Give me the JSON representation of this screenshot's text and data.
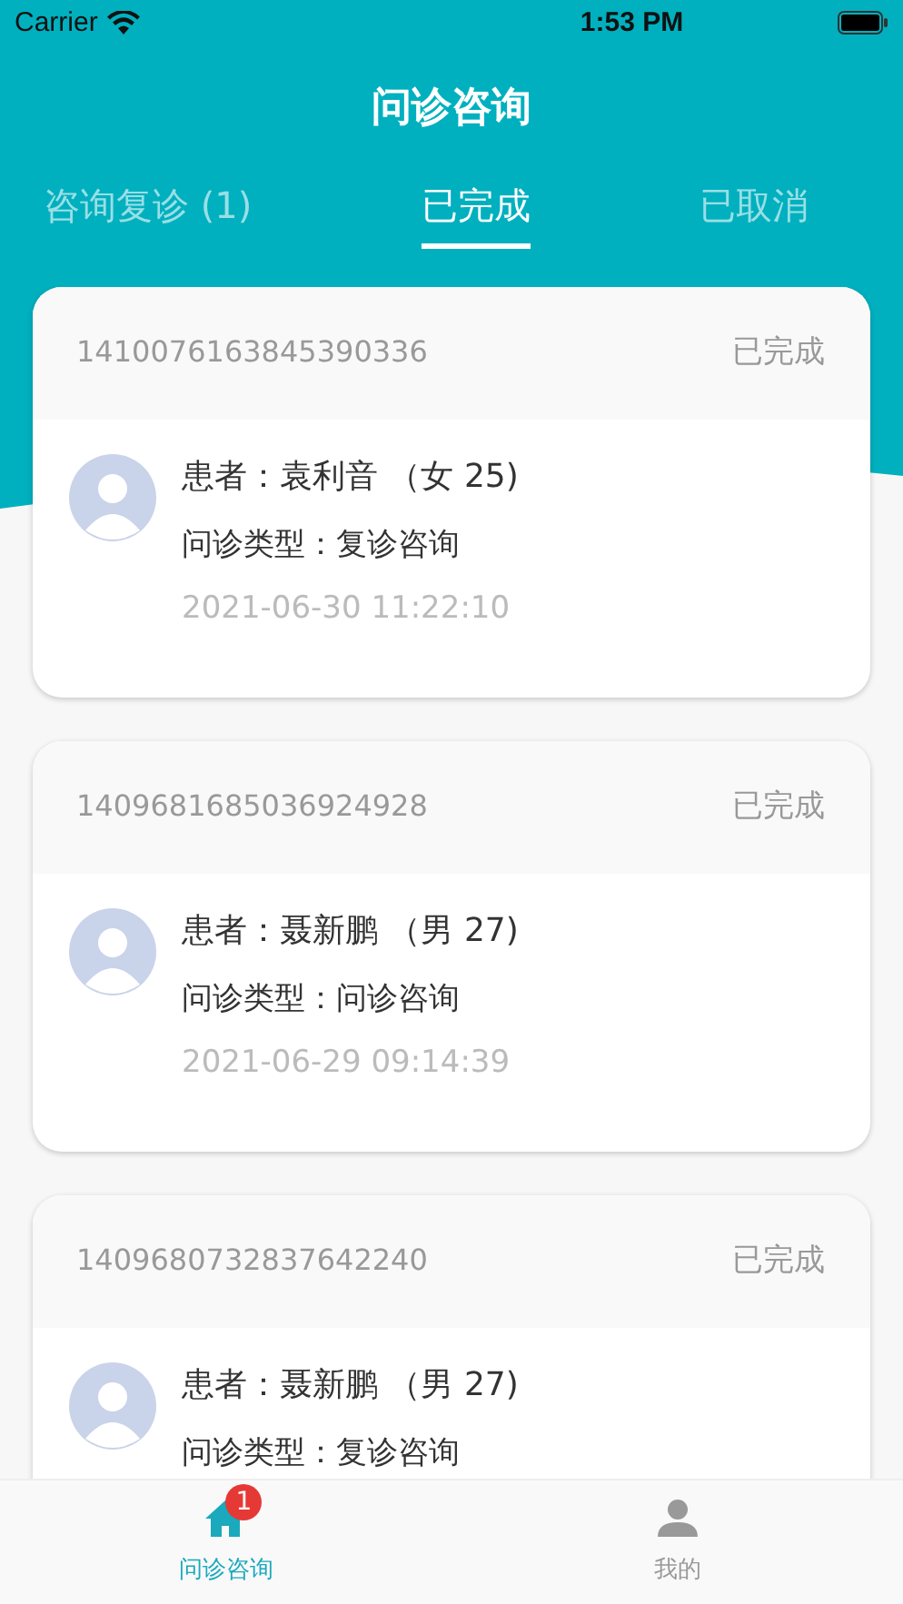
{
  "status_bar": {
    "carrier": "Carrier",
    "time": "1:53 PM"
  },
  "header": {
    "title": "问诊咨询"
  },
  "tabs": [
    {
      "label": "咨询复诊 (1)",
      "selected": false
    },
    {
      "label": "已完成",
      "selected": true
    },
    {
      "label": "已取消",
      "selected": false
    }
  ],
  "orders": [
    {
      "number": "1410076163845390336",
      "status": "已完成",
      "patient": "患者：袁利音 （女 25)",
      "type": "问诊类型：复诊咨询",
      "time": "2021-06-30 11:22:10"
    },
    {
      "number": "1409681685036924928",
      "status": "已完成",
      "patient": "患者：聂新鹏 （男 27)",
      "type": "问诊类型：问诊咨询",
      "time": "2021-06-29 09:14:39"
    },
    {
      "number": "1409680732837642240",
      "status": "已完成",
      "patient": "患者：聂新鹏 （男 27)",
      "type": "问诊类型：复诊咨询"
    }
  ],
  "tab_bar": [
    {
      "label": "问诊咨询",
      "kind": "home",
      "selected": true,
      "badge": "1"
    },
    {
      "label": "我的",
      "kind": "profile",
      "selected": false
    }
  ]
}
